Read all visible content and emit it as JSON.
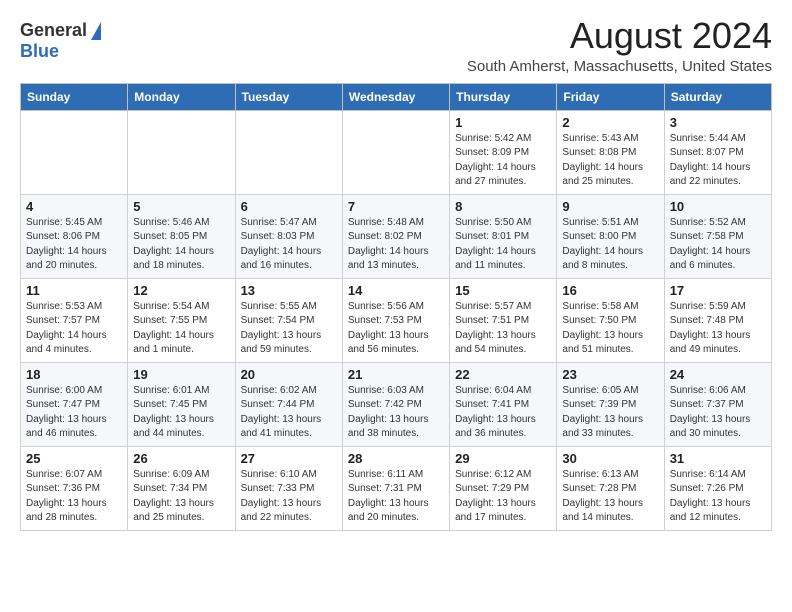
{
  "header": {
    "logo_general": "General",
    "logo_blue": "Blue",
    "title": "August 2024",
    "subtitle": "South Amherst, Massachusetts, United States"
  },
  "calendar": {
    "days_of_week": [
      "Sunday",
      "Monday",
      "Tuesday",
      "Wednesday",
      "Thursday",
      "Friday",
      "Saturday"
    ],
    "weeks": [
      [
        {
          "day": "",
          "info": ""
        },
        {
          "day": "",
          "info": ""
        },
        {
          "day": "",
          "info": ""
        },
        {
          "day": "",
          "info": ""
        },
        {
          "day": "1",
          "info": "Sunrise: 5:42 AM\nSunset: 8:09 PM\nDaylight: 14 hours and 27 minutes."
        },
        {
          "day": "2",
          "info": "Sunrise: 5:43 AM\nSunset: 8:08 PM\nDaylight: 14 hours and 25 minutes."
        },
        {
          "day": "3",
          "info": "Sunrise: 5:44 AM\nSunset: 8:07 PM\nDaylight: 14 hours and 22 minutes."
        }
      ],
      [
        {
          "day": "4",
          "info": "Sunrise: 5:45 AM\nSunset: 8:06 PM\nDaylight: 14 hours and 20 minutes."
        },
        {
          "day": "5",
          "info": "Sunrise: 5:46 AM\nSunset: 8:05 PM\nDaylight: 14 hours and 18 minutes."
        },
        {
          "day": "6",
          "info": "Sunrise: 5:47 AM\nSunset: 8:03 PM\nDaylight: 14 hours and 16 minutes."
        },
        {
          "day": "7",
          "info": "Sunrise: 5:48 AM\nSunset: 8:02 PM\nDaylight: 14 hours and 13 minutes."
        },
        {
          "day": "8",
          "info": "Sunrise: 5:50 AM\nSunset: 8:01 PM\nDaylight: 14 hours and 11 minutes."
        },
        {
          "day": "9",
          "info": "Sunrise: 5:51 AM\nSunset: 8:00 PM\nDaylight: 14 hours and 8 minutes."
        },
        {
          "day": "10",
          "info": "Sunrise: 5:52 AM\nSunset: 7:58 PM\nDaylight: 14 hours and 6 minutes."
        }
      ],
      [
        {
          "day": "11",
          "info": "Sunrise: 5:53 AM\nSunset: 7:57 PM\nDaylight: 14 hours and 4 minutes."
        },
        {
          "day": "12",
          "info": "Sunrise: 5:54 AM\nSunset: 7:55 PM\nDaylight: 14 hours and 1 minute."
        },
        {
          "day": "13",
          "info": "Sunrise: 5:55 AM\nSunset: 7:54 PM\nDaylight: 13 hours and 59 minutes."
        },
        {
          "day": "14",
          "info": "Sunrise: 5:56 AM\nSunset: 7:53 PM\nDaylight: 13 hours and 56 minutes."
        },
        {
          "day": "15",
          "info": "Sunrise: 5:57 AM\nSunset: 7:51 PM\nDaylight: 13 hours and 54 minutes."
        },
        {
          "day": "16",
          "info": "Sunrise: 5:58 AM\nSunset: 7:50 PM\nDaylight: 13 hours and 51 minutes."
        },
        {
          "day": "17",
          "info": "Sunrise: 5:59 AM\nSunset: 7:48 PM\nDaylight: 13 hours and 49 minutes."
        }
      ],
      [
        {
          "day": "18",
          "info": "Sunrise: 6:00 AM\nSunset: 7:47 PM\nDaylight: 13 hours and 46 minutes."
        },
        {
          "day": "19",
          "info": "Sunrise: 6:01 AM\nSunset: 7:45 PM\nDaylight: 13 hours and 44 minutes."
        },
        {
          "day": "20",
          "info": "Sunrise: 6:02 AM\nSunset: 7:44 PM\nDaylight: 13 hours and 41 minutes."
        },
        {
          "day": "21",
          "info": "Sunrise: 6:03 AM\nSunset: 7:42 PM\nDaylight: 13 hours and 38 minutes."
        },
        {
          "day": "22",
          "info": "Sunrise: 6:04 AM\nSunset: 7:41 PM\nDaylight: 13 hours and 36 minutes."
        },
        {
          "day": "23",
          "info": "Sunrise: 6:05 AM\nSunset: 7:39 PM\nDaylight: 13 hours and 33 minutes."
        },
        {
          "day": "24",
          "info": "Sunrise: 6:06 AM\nSunset: 7:37 PM\nDaylight: 13 hours and 30 minutes."
        }
      ],
      [
        {
          "day": "25",
          "info": "Sunrise: 6:07 AM\nSunset: 7:36 PM\nDaylight: 13 hours and 28 minutes."
        },
        {
          "day": "26",
          "info": "Sunrise: 6:09 AM\nSunset: 7:34 PM\nDaylight: 13 hours and 25 minutes."
        },
        {
          "day": "27",
          "info": "Sunrise: 6:10 AM\nSunset: 7:33 PM\nDaylight: 13 hours and 22 minutes."
        },
        {
          "day": "28",
          "info": "Sunrise: 6:11 AM\nSunset: 7:31 PM\nDaylight: 13 hours and 20 minutes."
        },
        {
          "day": "29",
          "info": "Sunrise: 6:12 AM\nSunset: 7:29 PM\nDaylight: 13 hours and 17 minutes."
        },
        {
          "day": "30",
          "info": "Sunrise: 6:13 AM\nSunset: 7:28 PM\nDaylight: 13 hours and 14 minutes."
        },
        {
          "day": "31",
          "info": "Sunrise: 6:14 AM\nSunset: 7:26 PM\nDaylight: 13 hours and 12 minutes."
        }
      ]
    ]
  }
}
